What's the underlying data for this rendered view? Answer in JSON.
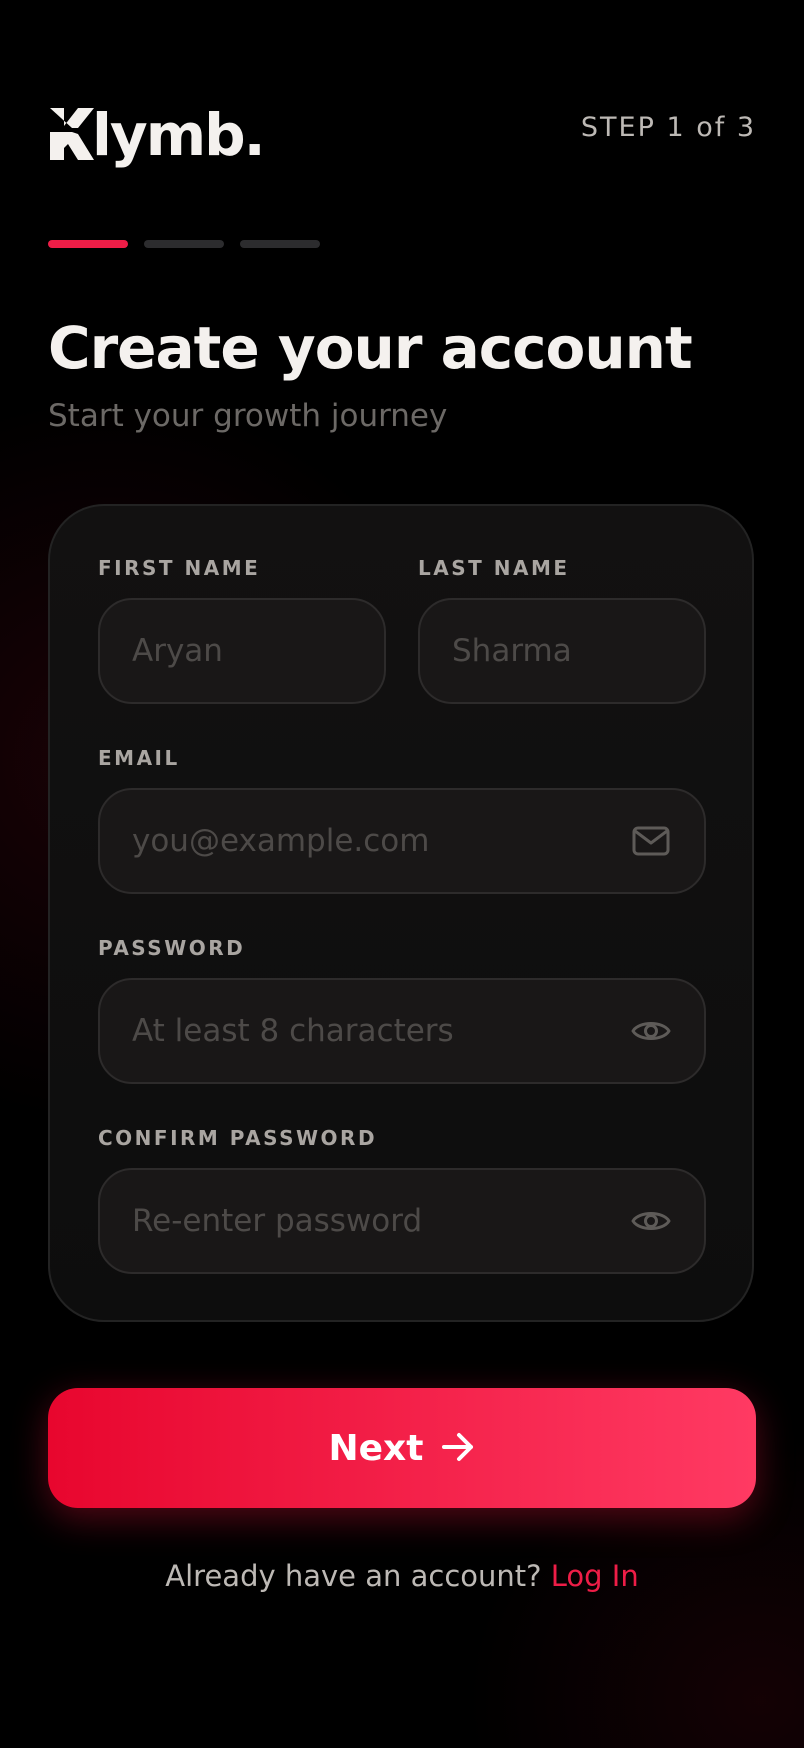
{
  "brand": {
    "name": "lymb.",
    "accent_color": "#ee1d47",
    "logo_icon": "stylized-k-icon"
  },
  "header": {
    "step_label": "STEP 1 of 3"
  },
  "progress": {
    "total_steps": 3,
    "current_step": 1
  },
  "page": {
    "title": "Create your account",
    "subtitle": "Start your growth journey"
  },
  "form": {
    "first_name": {
      "label": "FIRST NAME",
      "value": "",
      "placeholder": "Aryan"
    },
    "last_name": {
      "label": "LAST NAME",
      "value": "",
      "placeholder": "Sharma"
    },
    "email": {
      "label": "EMAIL",
      "value": "",
      "placeholder": "you@example.com",
      "icon": "mail-icon"
    },
    "password": {
      "label": "PASSWORD",
      "value": "",
      "placeholder": "At least 8 characters",
      "icon": "eye-icon"
    },
    "confirm_password": {
      "label": "CONFIRM PASSWORD",
      "value": "",
      "placeholder": "Re-enter password",
      "icon": "eye-icon"
    }
  },
  "actions": {
    "next_label": "Next",
    "next_icon": "arrow-right-icon"
  },
  "footer": {
    "prompt": "Already have an account?",
    "login_link": "Log In"
  }
}
